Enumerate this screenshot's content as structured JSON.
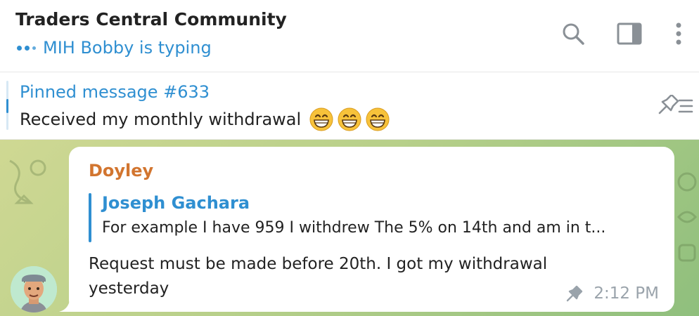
{
  "header": {
    "title": "Traders Central Community",
    "status": "MIH Bobby is typing",
    "icons": [
      "search-icon",
      "sidebar-toggle-icon",
      "more-vertical-icon"
    ]
  },
  "pinned": {
    "title": "Pinned message #633",
    "text": "Received my monthly withdrawal",
    "emojis": [
      "grinning-face",
      "grinning-face",
      "grinning-face"
    ],
    "icon": "pin-list-icon"
  },
  "message": {
    "sender": "Doyley",
    "reply": {
      "name": "Joseph Gachara",
      "text": "For example I have 959 I withdrew The 5% on 14th and am in t..."
    },
    "text": "Request must be made before 20th. I got my withdrawal yesterday",
    "time": "2:12 PM",
    "pinned_icon": "pin-icon"
  },
  "colors": {
    "accent": "#2f8fd1",
    "sender": "#d2752f",
    "chat_bg": "#b8d08a"
  }
}
